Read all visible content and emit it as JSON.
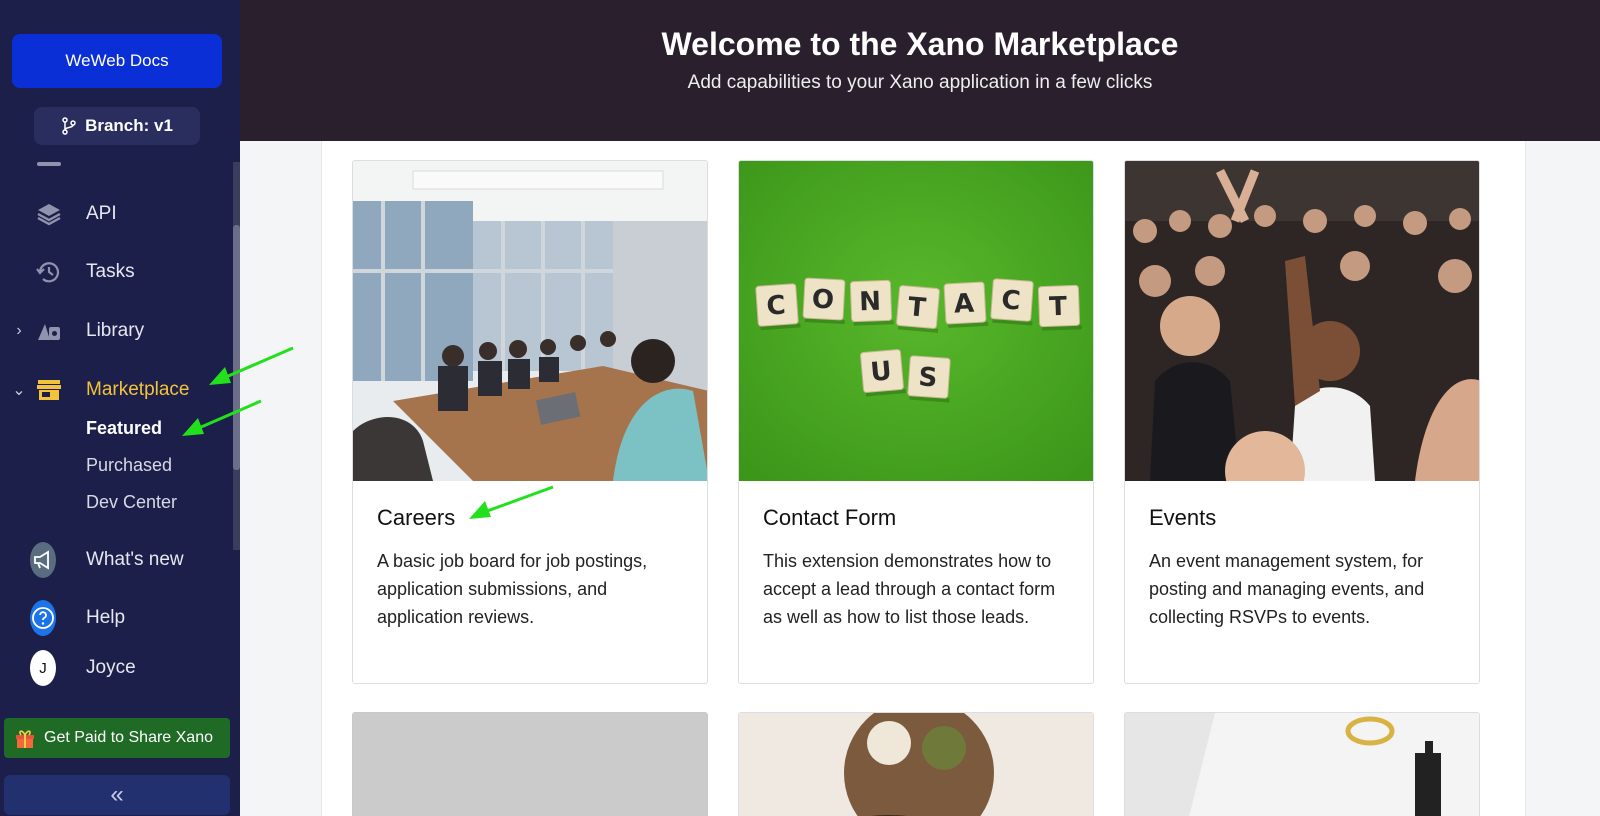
{
  "sidebar": {
    "docs_button": "WeWeb Docs",
    "branch_button": "Branch: v1",
    "items": [
      {
        "label": "API",
        "icon": "api-icon"
      },
      {
        "label": "Tasks",
        "icon": "history-icon"
      },
      {
        "label": "Library",
        "icon": "library-icon"
      },
      {
        "label": "Marketplace",
        "icon": "store-icon"
      }
    ],
    "marketplace_sub": [
      "Featured",
      "Purchased",
      "Dev Center"
    ],
    "whats_new": "What's new",
    "help": "Help",
    "user_initial": "J",
    "user_name": "Joyce",
    "share_button": "Get Paid to Share Xano",
    "collapse_icon": "«",
    "active_color": "#f3c33c"
  },
  "header": {
    "title": "Welcome to the Xano Marketplace",
    "subtitle": "Add capabilities to your Xano application in a few clicks"
  },
  "cards": [
    {
      "title": "Careers",
      "description": "A basic job board for job postings, application submissions, and application reviews."
    },
    {
      "title": "Contact Form",
      "description": "This extension demonstrates how to accept a lead through a contact form as well as how to list those leads."
    },
    {
      "title": "Events",
      "description": "An event management system, for posting and managing events, and collecting RSVPs to events."
    }
  ],
  "scrabble": {
    "word1": [
      "C",
      "O",
      "N",
      "T",
      "A",
      "C",
      "T"
    ],
    "word2": [
      "U",
      "S"
    ]
  },
  "annotation_color": "#22e01c"
}
